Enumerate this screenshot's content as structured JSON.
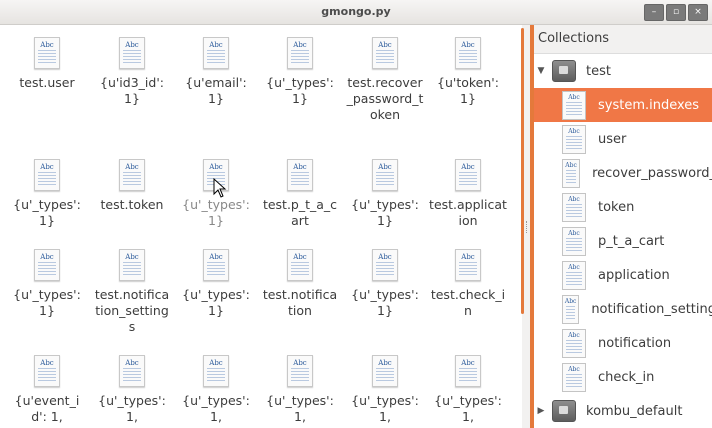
{
  "window": {
    "title": "gmongo.py"
  },
  "window_buttons": [
    "–",
    "▫",
    "×"
  ],
  "grid": [
    {
      "label": "test.user",
      "dim": false
    },
    {
      "label": "{u'id3_id': 1}",
      "dim": false
    },
    {
      "label": "{u'email': 1}",
      "dim": false
    },
    {
      "label": "{u'_types': 1}",
      "dim": false
    },
    {
      "label": "test.recover_password_token",
      "dim": false
    },
    {
      "label": "{u'token': 1}",
      "dim": false
    },
    {
      "label": "{u'_types': 1}",
      "dim": false
    },
    {
      "label": "test.token",
      "dim": false
    },
    {
      "label": "{u'_types': 1}",
      "dim": true
    },
    {
      "label": "test.p_t_a_cart",
      "dim": false
    },
    {
      "label": "{u'_types': 1}",
      "dim": false
    },
    {
      "label": "test.application",
      "dim": false
    },
    {
      "label": "{u'_types': 1}",
      "dim": false
    },
    {
      "label": "test.notification_settings",
      "dim": false
    },
    {
      "label": "{u'_types': 1}",
      "dim": false
    },
    {
      "label": "test.notification",
      "dim": false
    },
    {
      "label": "{u'_types': 1}",
      "dim": false
    },
    {
      "label": "test.check_in",
      "dim": false
    },
    {
      "label": "{u'event_id': 1,",
      "dim": false
    },
    {
      "label": "{u'_types': 1,",
      "dim": false
    },
    {
      "label": "{u'_types': 1,",
      "dim": false
    },
    {
      "label": "{u'_types': 1,",
      "dim": false
    },
    {
      "label": "{u'_types': 1,",
      "dim": false
    },
    {
      "label": "{u'_types': 1,",
      "dim": false
    }
  ],
  "panel": {
    "title": "Collections",
    "tree": [
      {
        "type": "db",
        "label": "test",
        "expanded": true
      },
      {
        "type": "col",
        "label": "system.indexes",
        "selected": true
      },
      {
        "type": "col",
        "label": "user"
      },
      {
        "type": "col",
        "label": "recover_password_"
      },
      {
        "type": "col",
        "label": "token"
      },
      {
        "type": "col",
        "label": "p_t_a_cart"
      },
      {
        "type": "col",
        "label": "application"
      },
      {
        "type": "col",
        "label": "notification_setting"
      },
      {
        "type": "col",
        "label": "notification"
      },
      {
        "type": "col",
        "label": "check_in"
      },
      {
        "type": "db",
        "label": "kombu_default",
        "expanded": false
      }
    ]
  },
  "icons": {
    "file": "document-abc-icon",
    "db": "database-folder-icon",
    "cursor": "mouse-pointer-icon"
  }
}
